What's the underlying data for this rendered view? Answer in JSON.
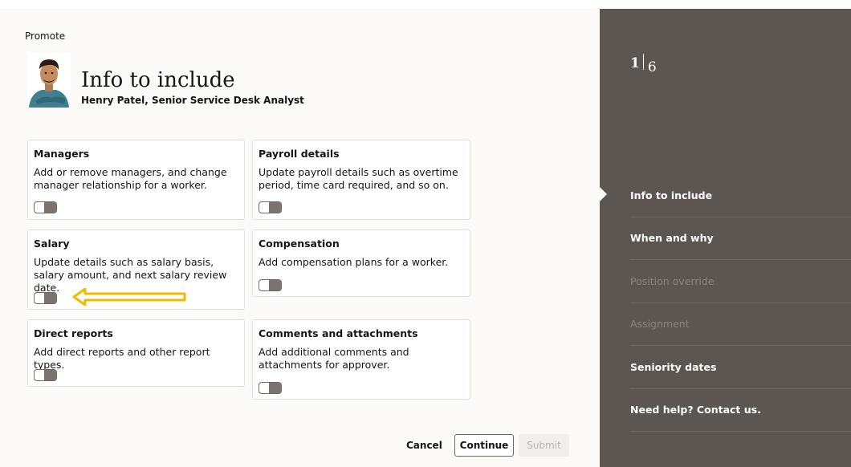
{
  "breadcrumb": "Promote",
  "header": {
    "title": "Info to include",
    "subtitle": "Henry Patel, Senior Service Desk Analyst"
  },
  "cards": {
    "managers": {
      "title": "Managers",
      "desc": "Add or remove managers, and change manager relationship for a worker."
    },
    "payroll": {
      "title": "Payroll details",
      "desc": "Update payroll details such as overtime period, time card required, and so on."
    },
    "salary": {
      "title": "Salary",
      "desc": "Update details such as salary basis, salary amount, and next salary review date."
    },
    "compensation": {
      "title": "Compensation",
      "desc": "Add compensation plans for a worker."
    },
    "direct_reports": {
      "title": "Direct reports",
      "desc": "Add direct reports and other report types."
    },
    "comments": {
      "title": "Comments and attachments",
      "desc": "Add additional comments and attachments for approver."
    }
  },
  "footer": {
    "cancel": "Cancel",
    "continue": "Continue",
    "submit": "Submit"
  },
  "sidebar": {
    "current_step": "1",
    "total_steps": "6",
    "steps": [
      {
        "label": "Info to include",
        "state": "current"
      },
      {
        "label": "When and why",
        "state": "enabled"
      },
      {
        "label": "Position override",
        "state": "disabled"
      },
      {
        "label": "Assignment",
        "state": "disabled"
      },
      {
        "label": "Seniority dates",
        "state": "enabled"
      },
      {
        "label": "Need help? Contact us.",
        "state": "enabled"
      }
    ]
  },
  "colors": {
    "sidebar_bg": "#5b5651",
    "annotation_arrow": "#f5b800",
    "main_bg": "#fbfaf9"
  }
}
